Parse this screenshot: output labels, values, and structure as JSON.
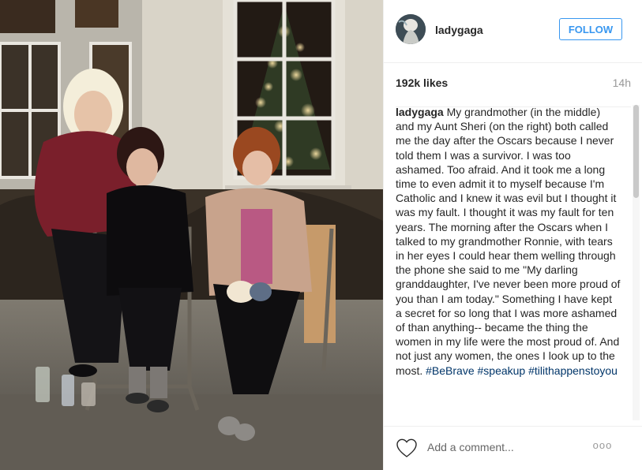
{
  "post": {
    "username": "ladygaga",
    "follow_label": "FOLLOW",
    "likes": "192k likes",
    "time_ago": "14h",
    "caption": {
      "user": "ladygaga",
      "text": " My grandmother (in the middle) and my Aunt Sheri (on the right) both called me the day after the Oscars because I never told them I was a survivor. I was too ashamed. Too afraid. And it took me a long time to even admit it to myself because I'm Catholic and I knew it was evil but I thought it was my fault. I thought it was my fault for ten years. The morning after the Oscars when I talked to my grandmother Ronnie, with tears in her eyes I could hear them welling through the phone she said to me \"My darling granddaughter, I've never been more proud of you than I am today.\" Something I have kept a secret for so long that I was more ashamed of than anything-- became the thing the women in my life were the most proud of. And not just any women, the ones I look up to the most. ",
      "hashtags": [
        "#BeBrave",
        "#speakup",
        "#tilithappenstoyou"
      ]
    },
    "comment_placeholder": "Add a comment...",
    "more_label": "ooo"
  },
  "icons": {
    "heart": "heart-icon",
    "more": "more-options-icon"
  },
  "colors": {
    "follow_blue": "#3897f0",
    "hashtag": "#003569",
    "text": "#262626",
    "muted": "#999999",
    "divider": "#efefef"
  }
}
